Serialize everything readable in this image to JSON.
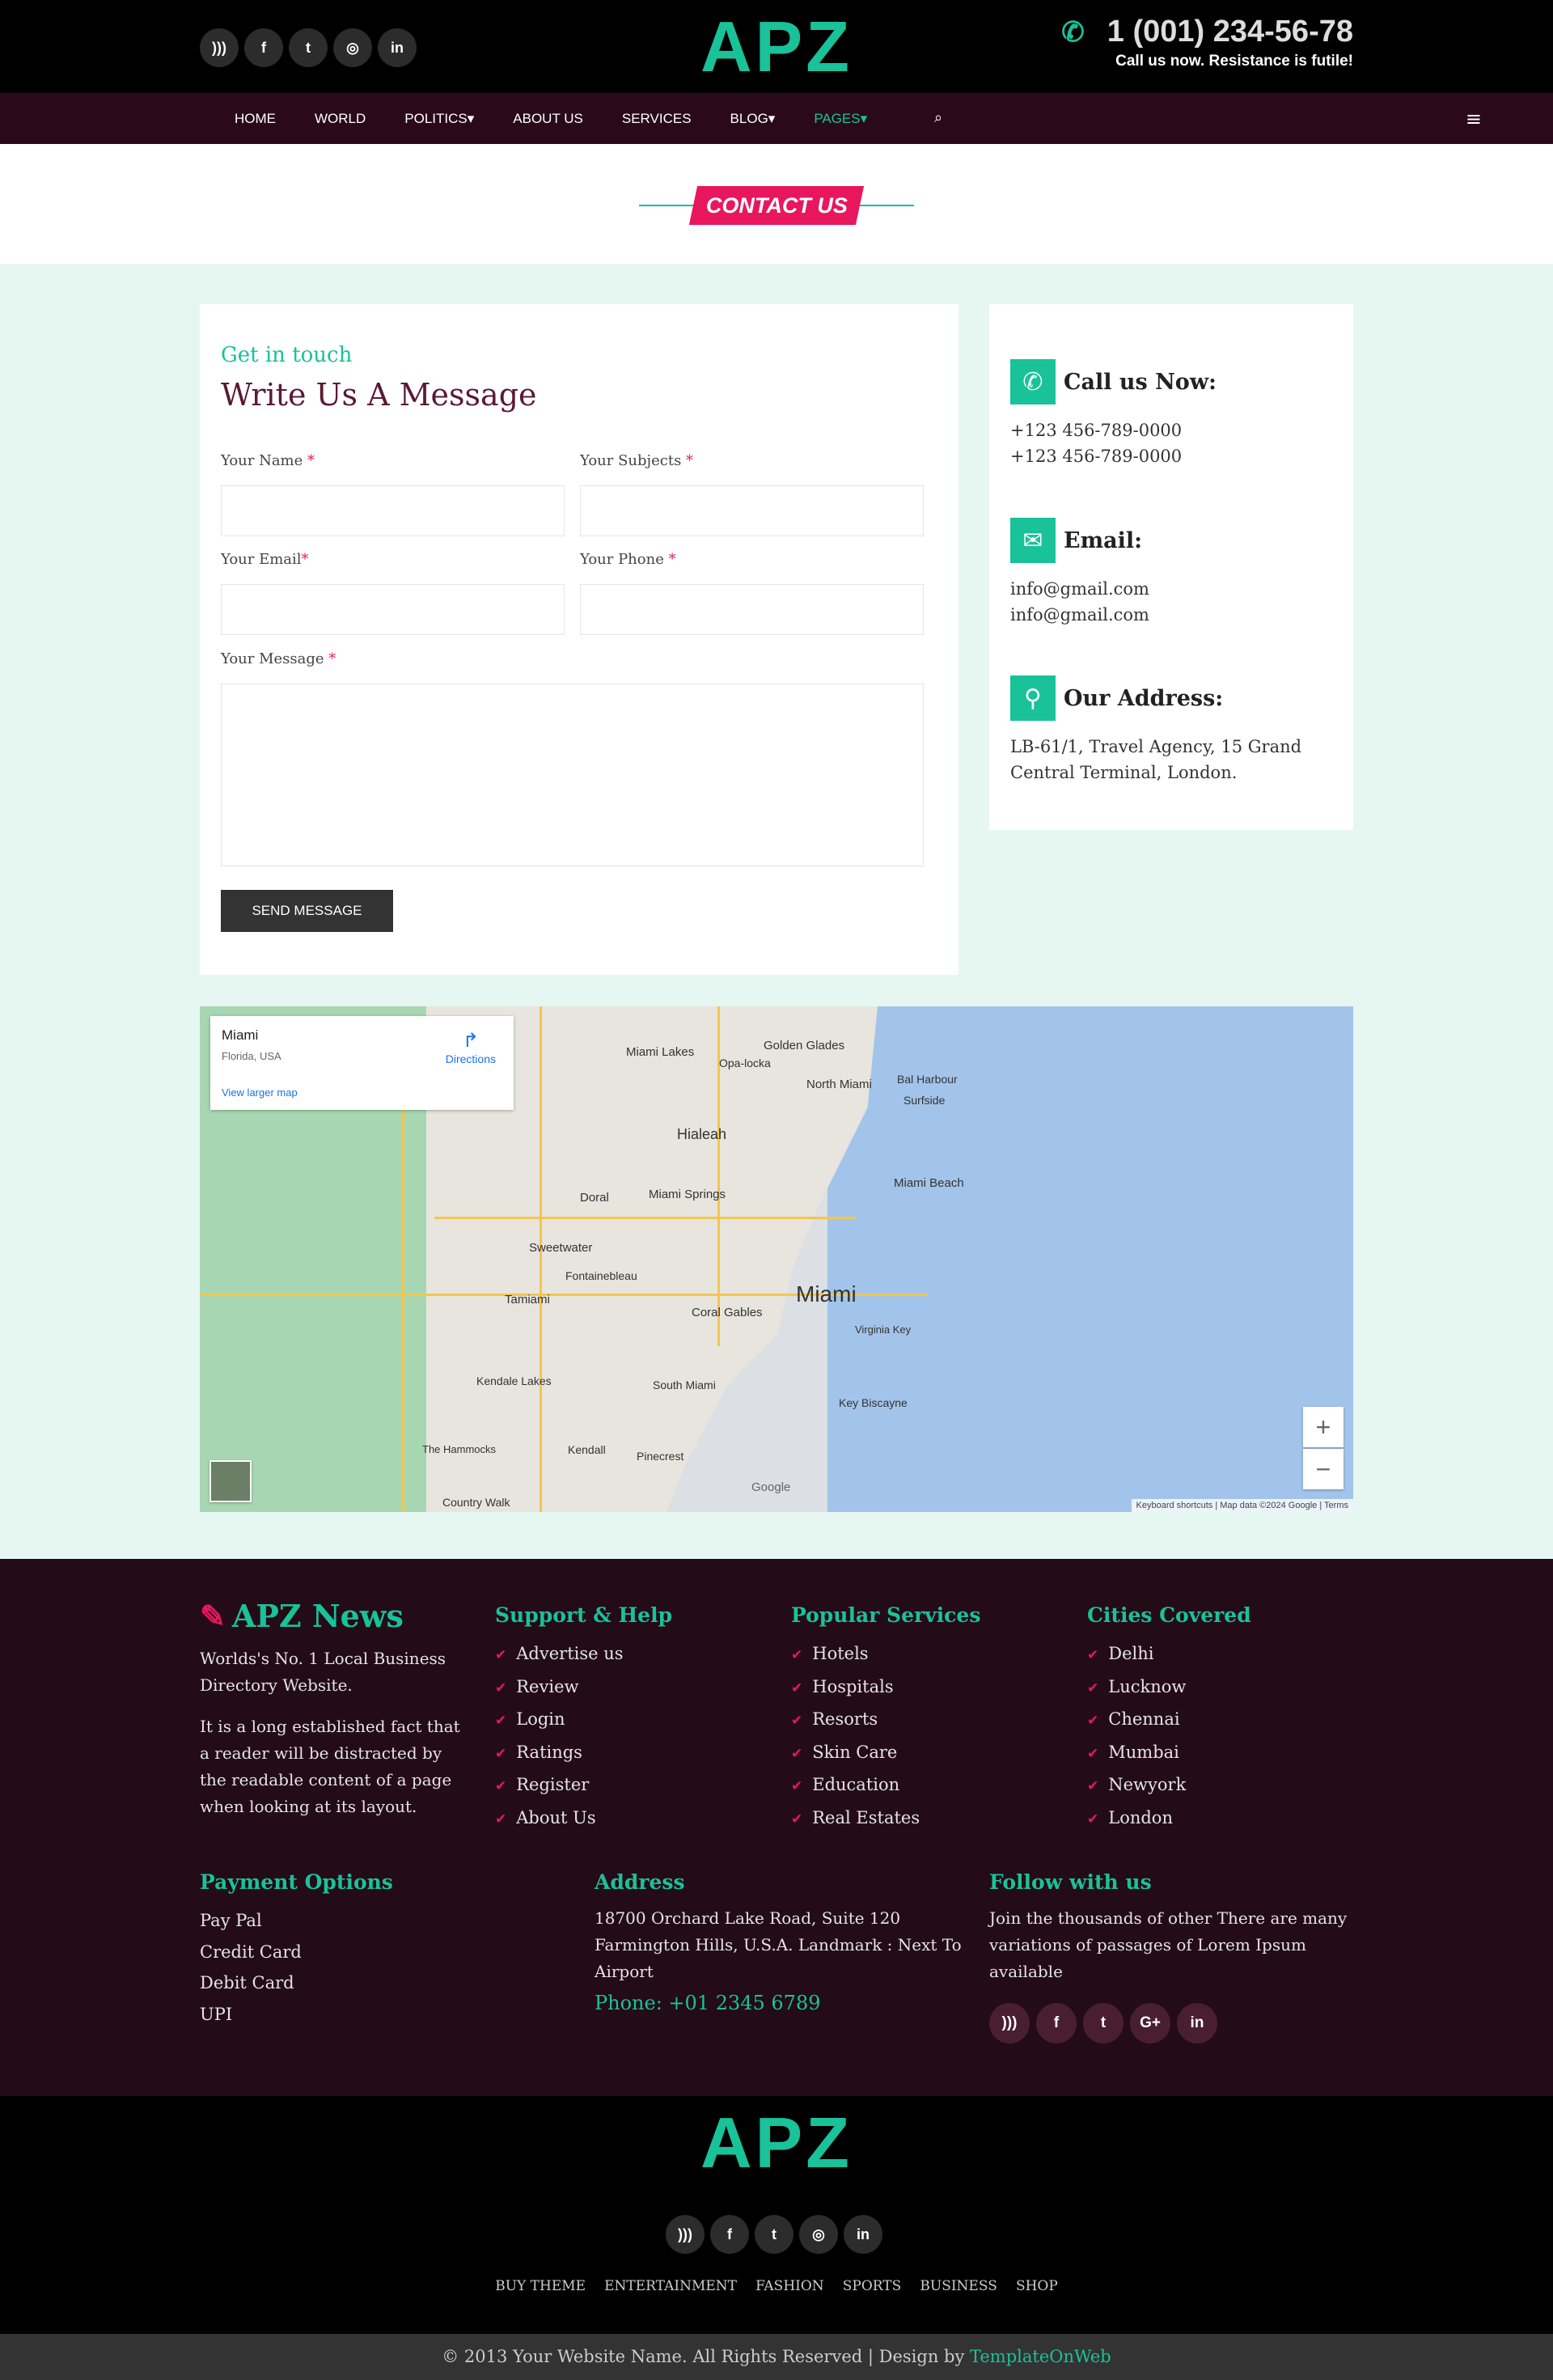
{
  "header": {
    "logo": "APZ",
    "phone": "1 (001) 234-56-78",
    "phone_sub": "Call us now. Resistance is futile!",
    "socials": [
      "rss-icon",
      "facebook-icon",
      "twitter-icon",
      "instagram-icon",
      "linkedin-icon"
    ]
  },
  "nav": {
    "items": [
      {
        "label": "HOME"
      },
      {
        "label": "WORLD"
      },
      {
        "label": "POLITICS▾"
      },
      {
        "label": "ABOUT US"
      },
      {
        "label": "SERVICES"
      },
      {
        "label": "BLOG▾"
      },
      {
        "label": "PAGES▾"
      }
    ],
    "active_index": 6
  },
  "page_title": "CONTACT US",
  "form": {
    "kicker": "Get in touch",
    "heading": "Write Us A Message",
    "labels": {
      "name": "Your Name",
      "subjects": "Your Subjects",
      "email": "Your Email",
      "phone": "Your Phone",
      "message": "Your Message"
    },
    "required_mark": "*",
    "send": "SEND MESSAGE"
  },
  "info": {
    "call": {
      "title": "Call us Now:",
      "line1": "+123 456-789-0000",
      "line2": "+123 456-789-0000"
    },
    "email": {
      "title": "Email:",
      "line1": "info@gmail.com",
      "line2": "info@gmail.com"
    },
    "address": {
      "title": "Our Address:",
      "line1": "LB-61/1, Travel Agency, 15 Grand",
      "line2": "Central Terminal, London."
    }
  },
  "map": {
    "city": "Miami",
    "region": "Florida, USA",
    "directions": "Directions",
    "larger": "View larger map",
    "center_label": "Miami",
    "labels": [
      "Hialeah",
      "Miami Lakes",
      "Golden Glades",
      "North Miami",
      "Doral",
      "Miami Springs",
      "Miami Beach",
      "Sweetwater",
      "Fontainebleau",
      "Tamiami",
      "Coral Gables",
      "Kendale Lakes",
      "South Miami",
      "Key Biscayne",
      "Kendall",
      "Pinecrest",
      "The Hammocks",
      "Country Walk",
      "Opa-locka",
      "Bal Harbour",
      "Surfside",
      "Virginia Key"
    ],
    "google": "Google",
    "attrib": "Keyboard shortcuts  |  Map data ©2024 Google  |  Terms",
    "zoom_in": "+",
    "zoom_out": "−"
  },
  "footer": {
    "brand": "APZ News",
    "brand_sub": "Worlds's No. 1 Local Business Directory Website.",
    "brand_desc": "It is a long established fact that a reader will be distracted by the readable content of a page when looking at its layout.",
    "support": {
      "title": "Support & Help",
      "items": [
        "Advertise us",
        "Review",
        "Login",
        "Ratings",
        "Register",
        "About Us"
      ]
    },
    "services": {
      "title": "Popular Services",
      "items": [
        "Hotels",
        "Hospitals",
        "Resorts",
        "Skin Care",
        "Education",
        "Real Estates"
      ]
    },
    "cities": {
      "title": "Cities Covered",
      "items": [
        "Delhi",
        "Lucknow",
        "Chennai",
        "Mumbai",
        "Newyork",
        "London"
      ]
    },
    "payment": {
      "title": "Payment Options",
      "items": [
        "Pay Pal",
        "Credit Card",
        "Debit Card",
        "UPI"
      ]
    },
    "address": {
      "title": "Address",
      "text": "18700 Orchard Lake Road, Suite 120 Farmington Hills, U.S.A. Landmark : Next To Airport",
      "phone": "Phone: +01 2345 6789"
    },
    "follow": {
      "title": "Follow with us",
      "text": "Join the thousands of other There are many variations of passages of Lorem Ipsum available"
    }
  },
  "bottom": {
    "logo": "APZ",
    "links": [
      "BUY THEME",
      "ENTERTAINMENT",
      "FASHION",
      "SPORTS",
      "BUSINESS",
      "SHOP"
    ],
    "copyright": "© 2013 Your Website Name. All Rights Reserved | Design by ",
    "copyright_link": "TemplateOnWeb"
  },
  "colors": {
    "accent": "#19c298",
    "brand_pink": "#e8175d",
    "nav_bg": "#2a0a1a",
    "footer_bg": "#240b18"
  }
}
